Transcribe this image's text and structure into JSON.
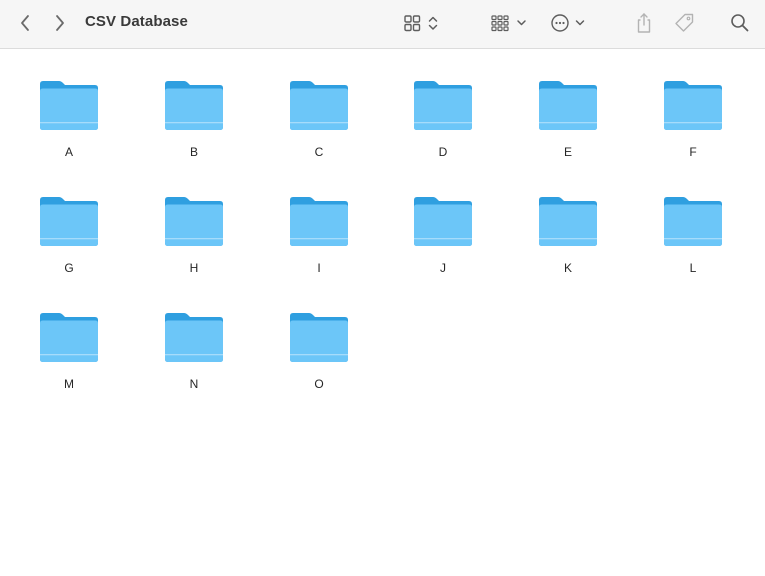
{
  "window": {
    "title": "CSV Database"
  },
  "toolbar": {
    "back_icon": "chevron-left-icon",
    "forward_icon": "chevron-right-icon",
    "view_icon": "icon-grid-view-icon",
    "group_icon": "group-grid-icon",
    "action_icon": "ellipsis-circle-icon",
    "share_icon": "share-icon",
    "tag_icon": "tag-icon",
    "search_icon": "search-icon"
  },
  "colors": {
    "folder_back": "#2f9fe0",
    "folder_front": "#6cc6f8",
    "folder_band": "#a6dcfb",
    "toolbar_bg": "#f6f6f6"
  },
  "folders": [
    {
      "name": "A"
    },
    {
      "name": "B"
    },
    {
      "name": "C"
    },
    {
      "name": "D"
    },
    {
      "name": "E"
    },
    {
      "name": "F"
    },
    {
      "name": "G"
    },
    {
      "name": "H"
    },
    {
      "name": "I"
    },
    {
      "name": "J"
    },
    {
      "name": "K"
    },
    {
      "name": "L"
    },
    {
      "name": "M"
    },
    {
      "name": "N"
    },
    {
      "name": "O"
    }
  ]
}
